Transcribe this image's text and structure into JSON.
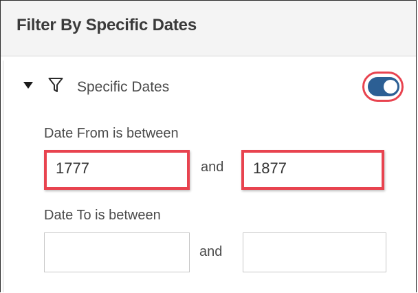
{
  "panel": {
    "title": "Filter By Specific Dates"
  },
  "filter": {
    "label": "Specific Dates",
    "enabled": true,
    "toggle_color": "#2c5f94",
    "highlight_color": "#e8434f"
  },
  "date_from": {
    "label": "Date From is between",
    "start_value": "1777",
    "end_value": "1877",
    "joiner": "and"
  },
  "date_to": {
    "label": "Date To is between",
    "start_value": "",
    "end_value": "",
    "joiner": "and"
  },
  "icons": {
    "expand": "caret-down-icon",
    "filter": "funnel-icon"
  }
}
